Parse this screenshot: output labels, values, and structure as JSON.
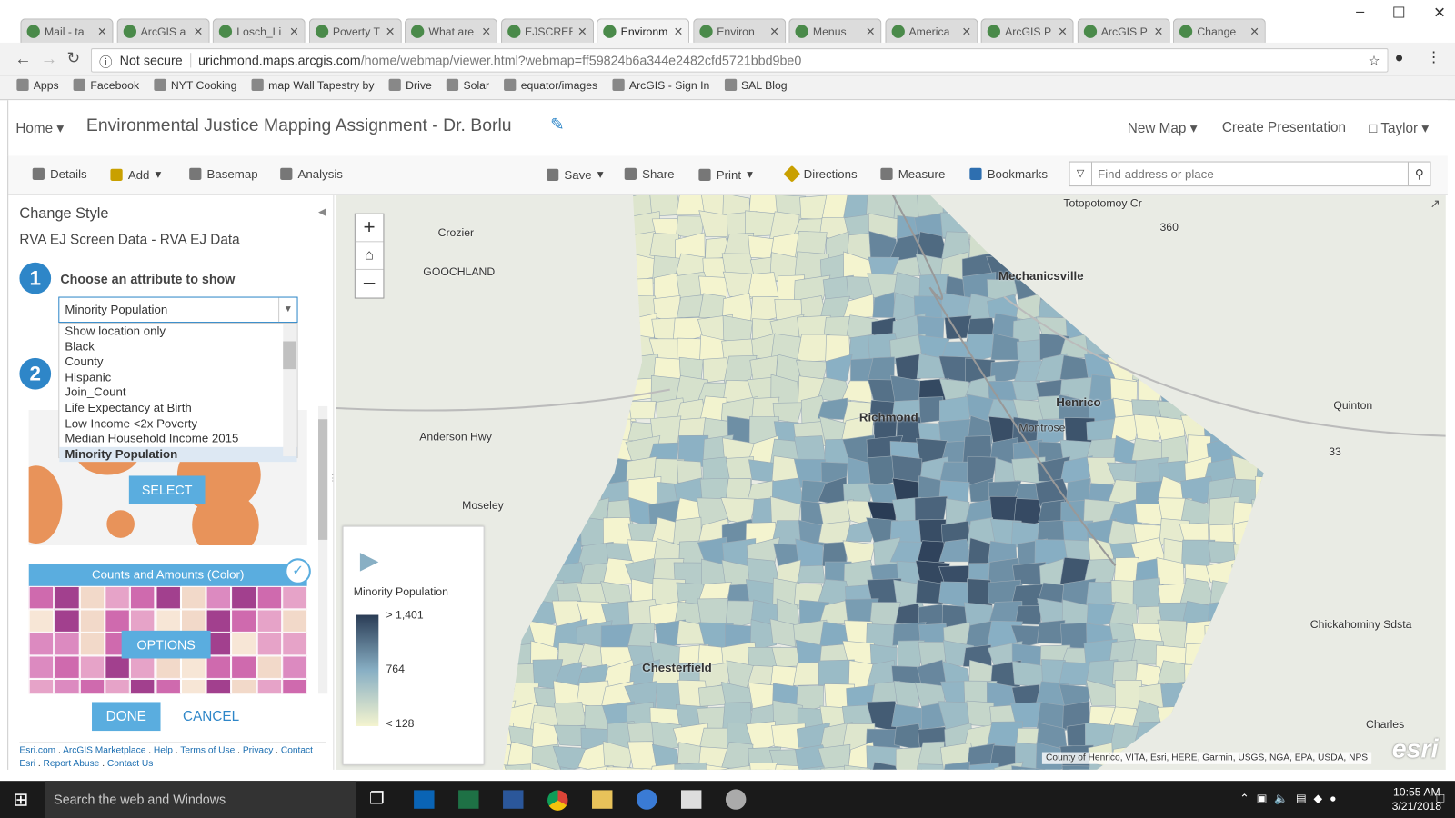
{
  "browser": {
    "tabs": [
      "Mail - ta",
      "ArcGIS a",
      "Losch_Li",
      "Poverty T",
      "What are",
      "EJSCREE",
      "Environm",
      "Environ",
      "Menus",
      "America",
      "ArcGIS P",
      "ArcGIS P",
      "Change"
    ],
    "active_tab": 6,
    "security": "Not secure",
    "url_host": "urichmond.maps.arcgis.com",
    "url_path": "/home/webmap/viewer.html?webmap=ff59824b6a344e2482cfd5721bbd9be0",
    "bookmarks": [
      "Apps",
      "Facebook",
      "NYT Cooking",
      "map Wall Tapestry by",
      "Drive",
      "Solar",
      "equator/images",
      "ArcGIS - Sign In",
      "SAL Blog"
    ]
  },
  "header": {
    "home": "Home",
    "title": "Environmental Justice Mapping Assignment - Dr. Borlu",
    "new_map": "New Map",
    "create_presentation": "Create Presentation",
    "user": "Taylor"
  },
  "toolbar": {
    "details": "Details",
    "add": "Add",
    "basemap": "Basemap",
    "analysis": "Analysis",
    "save": "Save",
    "share": "Share",
    "print": "Print",
    "directions": "Directions",
    "measure": "Measure",
    "bookmarks": "Bookmarks",
    "search_placeholder": "Find address or place"
  },
  "panel": {
    "title": "Change Style",
    "layer": "RVA EJ Screen Data - RVA EJ Data",
    "step1": "1",
    "step1_label": "Choose an attribute to show",
    "step2": "2",
    "selected_attribute": "Minority Population",
    "options": [
      "Show location only",
      "Black",
      "County",
      "Hispanic",
      "Join_Count",
      "Life Expectancy at Birth",
      "Low Income <2x Poverty",
      "Median Household Income 2015",
      "Minority Population"
    ],
    "select_label": "SELECT",
    "style_name": "Counts and Amounts (Color)",
    "options_label": "OPTIONS",
    "done": "DONE",
    "cancel": "CANCEL",
    "footer": [
      "Esri.com",
      "ArcGIS Marketplace",
      "Help",
      "Terms of Use",
      "Privacy",
      "Contact Esri",
      "Report Abuse",
      "Contact Us"
    ]
  },
  "map": {
    "labels": [
      "Crozier",
      "GOOCHLAND",
      "Mechanicsville",
      "Richmond",
      "Henrico",
      "Quinton",
      "Anderson Hwy",
      "Chesterfield",
      "Chickahominy Sdsta",
      "Charles",
      "Totopotomoy Cr",
      "Montrose",
      "Moseley",
      "33",
      "360"
    ],
    "attribution": "County of Henrico, VITA, Esri, HERE, Garmin, USGS, NGA, EPA, USDA, NPS",
    "legend": {
      "title": "Minority Population",
      "max": "> 1,401",
      "mid": "764",
      "min": "< 128"
    },
    "colors": {
      "low": "#f4f4cf",
      "mid": "#88afc4",
      "high": "#2a3c55"
    }
  },
  "taskbar": {
    "search": "Search the web and Windows",
    "time": "10:55 AM",
    "date": "3/21/2018"
  }
}
